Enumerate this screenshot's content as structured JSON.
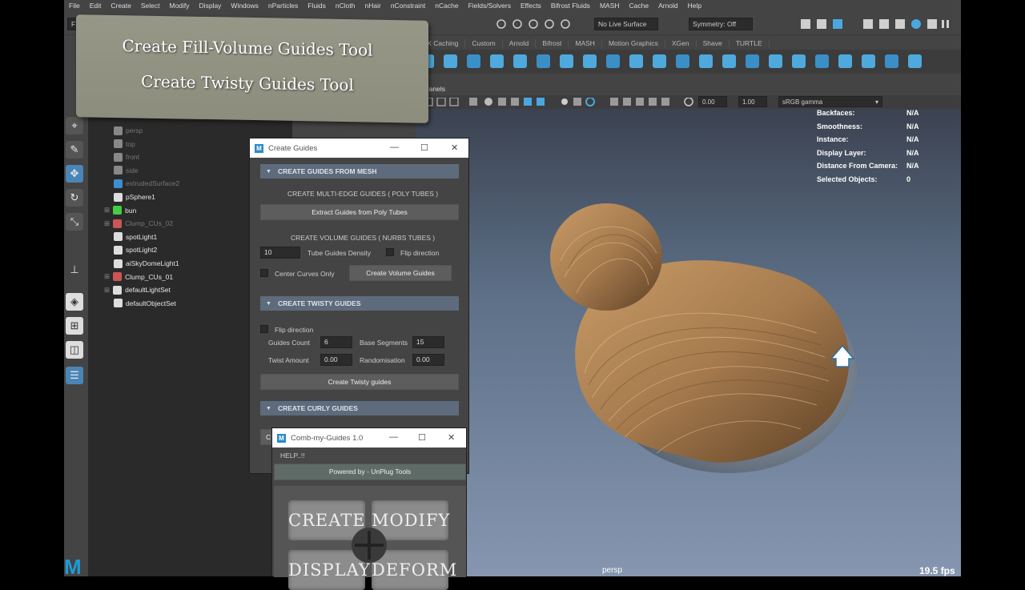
{
  "menubar": [
    "File",
    "Edit",
    "Create",
    "Select",
    "Modify",
    "Display",
    "Windows",
    "nParticles",
    "Fluids",
    "nCloth",
    "nHair",
    "nConstraint",
    "nCache",
    "Fields/Solvers",
    "Effects",
    "Bifrost Fluids",
    "MASH",
    "Cache",
    "Arnold",
    "Help"
  ],
  "status": {
    "menuset": "FX",
    "live_surface": "No Live Surface",
    "symmetry": "Symmetry: Off"
  },
  "shelf_tabs": [
    "FX Caching",
    "Custom",
    "Arnold",
    "Bifrost",
    "MASH",
    "Motion Graphics",
    "XGen",
    "Shave",
    "TURTLE"
  ],
  "panels_label": "Panels",
  "viewport_toolbar": {
    "val1": "0.00",
    "val2": "1.00",
    "colorspace": "sRGB gamma"
  },
  "hud": [
    {
      "label": "Backfaces:",
      "value": "N/A"
    },
    {
      "label": "Smoothness:",
      "value": "N/A"
    },
    {
      "label": "Instance:",
      "value": "N/A"
    },
    {
      "label": "Display Layer:",
      "value": "N/A"
    },
    {
      "label": "Distance From Camera:",
      "value": "N/A"
    },
    {
      "label": "Selected Objects:",
      "value": "0"
    }
  ],
  "camera_label": "persp",
  "fps": "19.5 fps",
  "outliner": [
    {
      "name": "persp",
      "dim": true
    },
    {
      "name": "top",
      "dim": true
    },
    {
      "name": "front",
      "dim": true
    },
    {
      "name": "side",
      "dim": true
    },
    {
      "name": "extrudedSurface2",
      "dim": true
    },
    {
      "name": "pSphere1",
      "dim": false
    },
    {
      "name": "bun",
      "dim": false,
      "expand": true
    },
    {
      "name": "Clump_CUs_02",
      "dim": true,
      "expand": true
    },
    {
      "name": "spotLight1",
      "dim": false
    },
    {
      "name": "spotLight2",
      "dim": false
    },
    {
      "name": "aiSkyDomeLight1",
      "dim": false
    },
    {
      "name": "Clump_CUs_01",
      "dim": false,
      "expand": true
    },
    {
      "name": "defaultLightSet",
      "dim": false,
      "expand": true
    },
    {
      "name": "defaultObjectSet",
      "dim": false
    }
  ],
  "banner": {
    "line1": "Create Fill-Volume Guides Tool",
    "line2": "Create Twisty Guides Tool"
  },
  "create_guides": {
    "title": "Create Guides",
    "sec1": "CREATE GUIDES FROM MESH",
    "multi_edge": "CREATE MULTI-EDGE GUIDES ( POLY TUBES )",
    "extract_btn": "Extract Guides from Poly Tubes",
    "volume_hdr": "CREATE VOLUME GUIDES ( NURBS TUBES )",
    "density_value": "10",
    "density_label": "Tube Guides Density",
    "flip_label": "Flip direction",
    "center_curves": "Center Curves Only",
    "volume_btn": "Create Volume Guides",
    "sec2": "CREATE TWISTY GUIDES",
    "flip2_label": "Flip direction",
    "guides_count_label": "Guides Count",
    "guides_count": "6",
    "base_segments_label": "Base Segments",
    "base_segments": "15",
    "twist_label": "Twist Amount",
    "twist": "0.00",
    "random_label": "Randomisation",
    "random": "0.00",
    "twisty_btn": "Create Twisty guides",
    "sec3": "CREATE CURLY GUIDES",
    "partial": "C"
  },
  "comb": {
    "title": "Comb-my-Guides 1.0",
    "help": "HELP..!!",
    "powered": "Powered by - UnPlug Tools",
    "create": "CREATE",
    "modify": "MODIFY",
    "display": "DISPLAY",
    "deform": "DEFORM"
  },
  "colors": {
    "accent": "#5d6b7d",
    "maya_blue": "#1d9bd8",
    "hair": "#a67b4e"
  },
  "logo_text": "M"
}
